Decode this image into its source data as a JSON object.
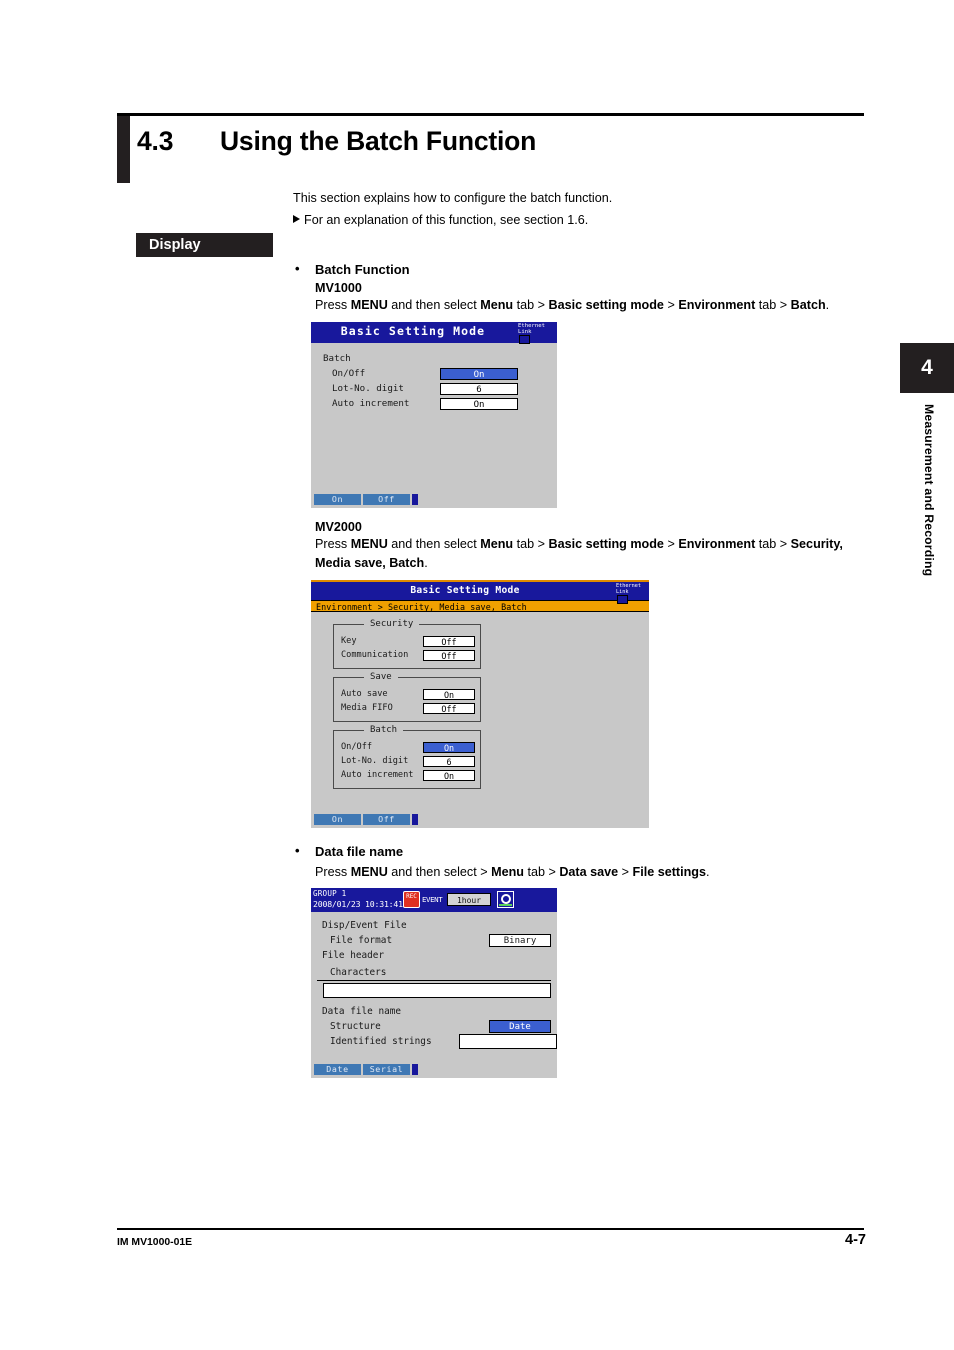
{
  "section": {
    "number": "4.3",
    "title": "Using the Batch Function"
  },
  "intro": {
    "line1": "This section explains how to configure the batch function.",
    "line2": "For an explanation of this function, see section 1.6."
  },
  "display_tag": "Display",
  "batch_function": {
    "heading": "Batch Function",
    "mv1000": {
      "label": "MV1000",
      "instruction_parts": [
        "Press ",
        "MENU",
        " and then select ",
        "Menu",
        " tab > ",
        "Basic setting mode",
        " > ",
        "Environment",
        " tab > ",
        "Batch",
        "."
      ],
      "screen": {
        "title": "Basic Setting Mode",
        "ethernet_line1": "Ethernet",
        "ethernet_line2": "Link",
        "group_label": "Batch",
        "rows": [
          {
            "label": "On/Off",
            "value": "On",
            "selected": true
          },
          {
            "label": "Lot-No. digit",
            "value": "6",
            "selected": false
          },
          {
            "label": "Auto increment",
            "value": "On",
            "selected": false
          }
        ],
        "softkeys": [
          "On",
          "Off"
        ]
      }
    },
    "mv2000": {
      "label": "MV2000",
      "instruction_parts": [
        "Press ",
        "MENU",
        " and then select ",
        "Menu",
        " tab > ",
        "Basic setting mode",
        " > ",
        "Environment",
        " tab > ",
        "Security, Media save, Batch",
        "."
      ],
      "screen": {
        "title": "Basic Setting Mode",
        "ethernet_line1": "Ethernet",
        "ethernet_line2": "Link",
        "breadcrumb": "Environment > Security, Media save, Batch",
        "groups": [
          {
            "caption": "Security",
            "rows": [
              {
                "label": "Key",
                "value": "Off",
                "selected": false
              },
              {
                "label": "Communication",
                "value": "Off",
                "selected": false
              }
            ]
          },
          {
            "caption": "Save",
            "rows": [
              {
                "label": "Auto save",
                "value": "On",
                "selected": false
              },
              {
                "label": "Media FIFO",
                "value": "Off",
                "selected": false
              }
            ]
          },
          {
            "caption": "Batch",
            "rows": [
              {
                "label": "On/Off",
                "value": "On",
                "selected": true
              },
              {
                "label": "Lot-No. digit",
                "value": "6",
                "selected": false
              },
              {
                "label": "Auto increment",
                "value": "On",
                "selected": false
              }
            ]
          }
        ],
        "softkeys": [
          "On",
          "Off"
        ]
      }
    }
  },
  "data_file_name": {
    "heading": "Data file name",
    "instruction_parts": [
      "Press ",
      "MENU",
      " and then select > ",
      "Menu",
      " tab > ",
      "Data save",
      " > ",
      "File settings",
      "."
    ],
    "screen": {
      "group_title": "GROUP 1",
      "timestamp": "2008/01/23 10:31:41",
      "event_label": "EVENT",
      "rate_value": "1hour",
      "sections": {
        "disp_event_file": "Disp/Event File",
        "file_format_label": "File format",
        "file_format_value": "Binary",
        "file_header": "File header",
        "characters_label": "Characters",
        "characters_value": "",
        "data_file_name": "Data file name",
        "structure_label": "Structure",
        "structure_value": "Date",
        "identified_strings_label": "Identified strings",
        "identified_strings_value": ""
      },
      "softkeys": [
        "Date",
        "Serial"
      ]
    }
  },
  "chapter_tab": {
    "number": "4",
    "label": "Measurement and Recording"
  },
  "footer": {
    "left": "IM MV1000-01E",
    "right": "4-7"
  },
  "colors": {
    "accent_blue": "#18189c",
    "selected_blue": "#3b5fd0",
    "breadcrumb_orange": "#f0a000",
    "screen_gray": "#c8c8c8",
    "ink": "#231f20"
  }
}
